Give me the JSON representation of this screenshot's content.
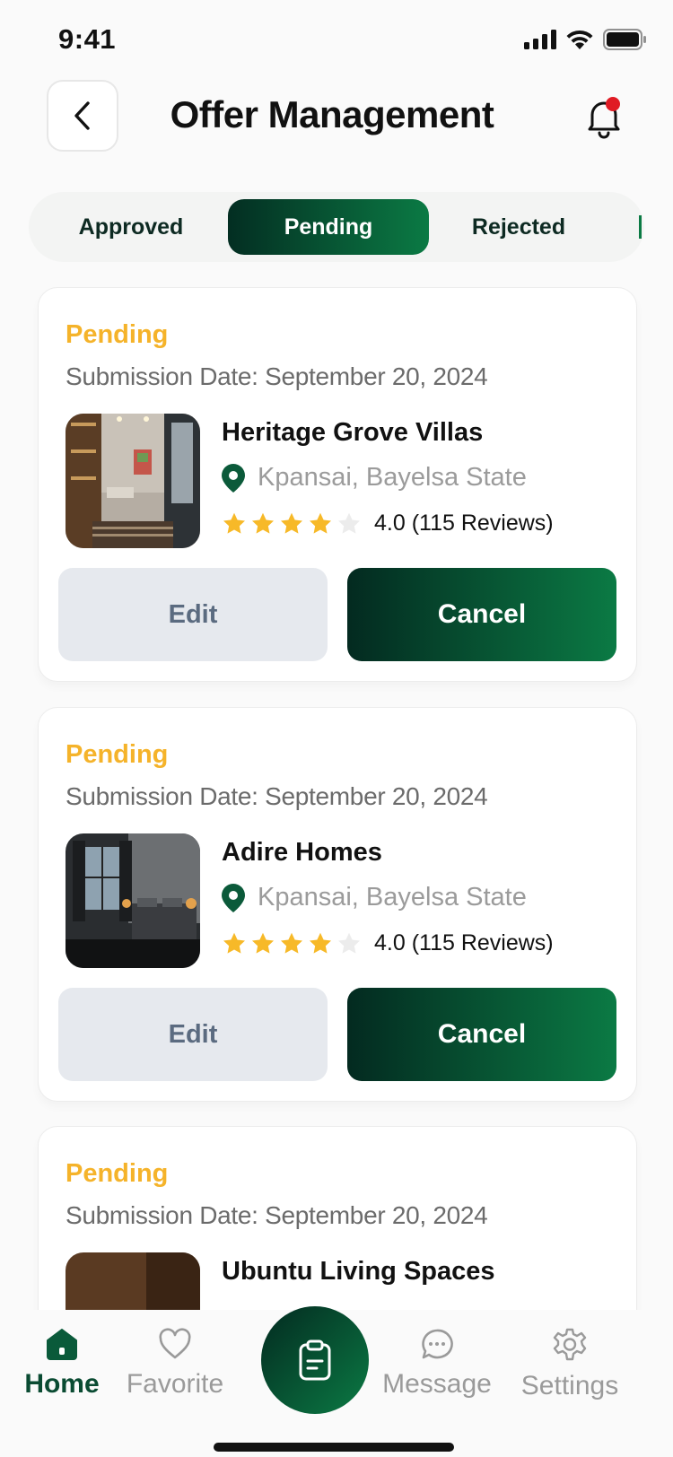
{
  "status_bar": {
    "time": "9:41"
  },
  "header": {
    "title": "Offer Management"
  },
  "tabs": [
    {
      "label": "Approved",
      "active": false
    },
    {
      "label": "Pending",
      "active": true
    },
    {
      "label": "Rejected",
      "active": false
    }
  ],
  "offers": [
    {
      "status": "Pending",
      "submission": "Submission Date: September 20, 2024",
      "name": "Heritage Grove Villas",
      "location": "Kpansai, Bayelsa State",
      "rating": 4.0,
      "rating_text": "4.0 (115 Reviews)",
      "edit_label": "Edit",
      "cancel_label": "Cancel"
    },
    {
      "status": "Pending",
      "submission": "Submission Date: September 20, 2024",
      "name": "Adire Homes",
      "location": "Kpansai, Bayelsa State",
      "rating": 4.0,
      "rating_text": "4.0 (115 Reviews)",
      "edit_label": "Edit",
      "cancel_label": "Cancel"
    },
    {
      "status": "Pending",
      "submission": "Submission Date: September 20, 2024",
      "name": "Ubuntu Living Spaces"
    }
  ],
  "nav": {
    "home": "Home",
    "favorite": "Favorite",
    "message": "Message",
    "settings": "Settings"
  },
  "colors": {
    "primary_dark": "#032a20",
    "primary": "#0b7a44",
    "pending": "#f5b32a",
    "star": "#f7b928",
    "notification_dot": "#e01b24"
  }
}
